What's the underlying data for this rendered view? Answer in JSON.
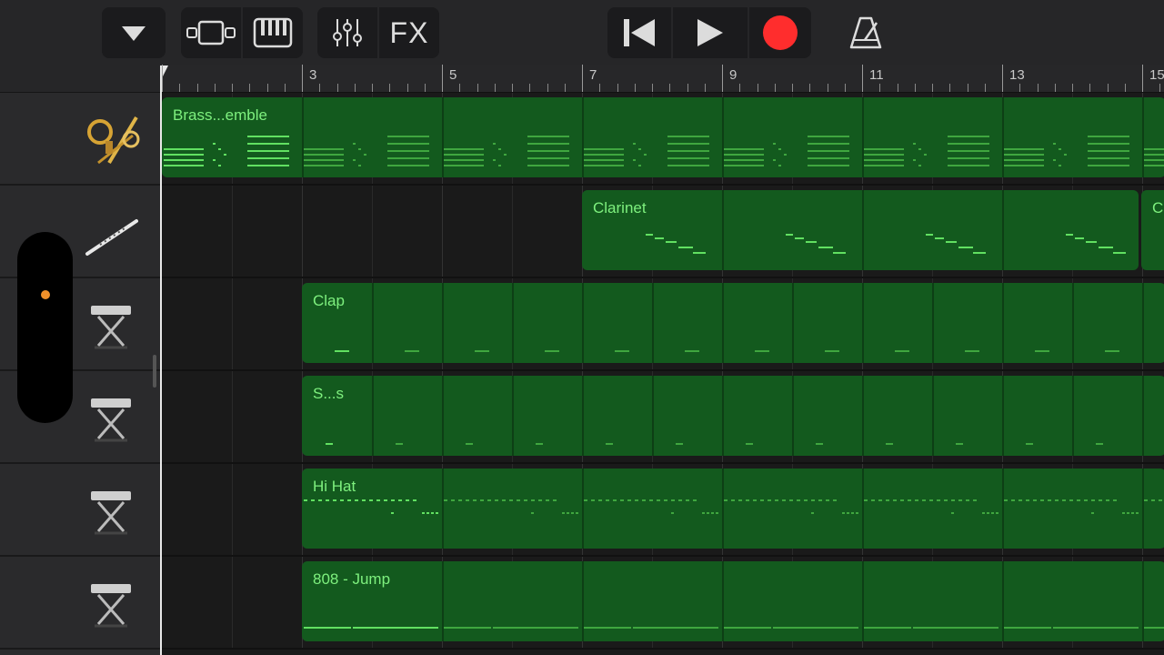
{
  "toolbar": {
    "dropdown_icon": "triangle-down-icon",
    "view_icons": [
      "tracks-view-icon",
      "keyboard-icon"
    ],
    "mixer_icon": "mixer-sliders-icon",
    "fx_label": "FX",
    "transport_icons": [
      "skip-back-icon",
      "play-icon",
      "record-icon"
    ],
    "metronome_icon": "metronome-icon",
    "record_color": "#ff2d2d"
  },
  "ruler": {
    "bar_numbers": [
      "3",
      "5",
      "7",
      "9",
      "11",
      "13",
      "15"
    ]
  },
  "tracks": [
    {
      "name": "Brass Ensemble",
      "icon": "brass-icon",
      "regions": [
        {
          "label": "Brass...emble"
        }
      ]
    },
    {
      "name": "Clarinet",
      "icon": "clarinet-icon",
      "regions": [
        {
          "label": "Clarinet"
        },
        {
          "label": "C"
        }
      ]
    },
    {
      "name": "Clap",
      "icon": "keyboard-stand-icon",
      "regions": [
        {
          "label": "Clap"
        }
      ]
    },
    {
      "name": "S...s",
      "icon": "keyboard-stand-icon",
      "regions": [
        {
          "label": "S...s"
        }
      ]
    },
    {
      "name": "Hi Hat",
      "icon": "keyboard-stand-icon",
      "regions": [
        {
          "label": "Hi Hat"
        }
      ]
    },
    {
      "name": "808 - Jump",
      "icon": "keyboard-stand-icon",
      "regions": [
        {
          "label": "808 - Jump"
        }
      ]
    }
  ],
  "colors": {
    "region_fill": "#135a1e",
    "region_text": "#7ef07e",
    "volume_knob": "#f0902a"
  }
}
